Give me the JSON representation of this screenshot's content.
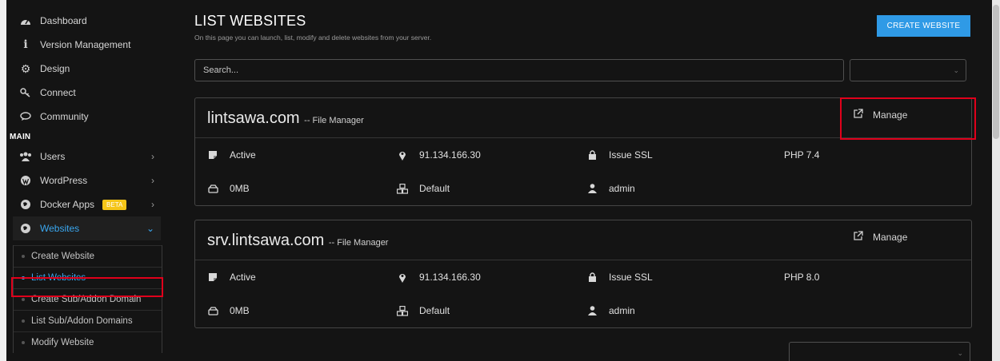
{
  "sidebar": {
    "top_items": [
      {
        "label": "Dashboard",
        "icon": "dashboard-icon"
      },
      {
        "label": "Version Management",
        "icon": "info-icon"
      },
      {
        "label": "Design",
        "icon": "gear-icon"
      },
      {
        "label": "Connect",
        "icon": "key-icon"
      },
      {
        "label": "Community",
        "icon": "chat-icon"
      }
    ],
    "section_main": "MAIN",
    "main_items": [
      {
        "label": "Users",
        "chevron": "›"
      },
      {
        "label": "WordPress",
        "chevron": "›"
      },
      {
        "label": "Docker Apps",
        "badge": "BETA",
        "chevron": "›"
      },
      {
        "label": "Websites",
        "chevron": "⌄"
      }
    ],
    "submenu": [
      {
        "label": "Create Website"
      },
      {
        "label": "List Websites"
      },
      {
        "label": "Create Sub/Addon Domain"
      },
      {
        "label": "List Sub/Addon Domains"
      },
      {
        "label": "Modify Website"
      }
    ]
  },
  "header": {
    "title": "LIST WEBSITES",
    "subtitle": "On this page you can launch, list, modify and delete websites from your server.",
    "create_button": "CREATE WEBSITE"
  },
  "search": {
    "placeholder": "Search..."
  },
  "websites": [
    {
      "domain": "lintsawa.com",
      "file_manager": "-- File Manager",
      "manage": "Manage",
      "status": "Active",
      "ip": "91.134.166.30",
      "ssl": "Issue SSL",
      "php": "PHP 7.4",
      "disk": "0MB",
      "package": "Default",
      "owner": "admin"
    },
    {
      "domain": "srv.lintsawa.com",
      "file_manager": "-- File Manager",
      "manage": "Manage",
      "status": "Active",
      "ip": "91.134.166.30",
      "ssl": "Issue SSL",
      "php": "PHP 8.0",
      "disk": "0MB",
      "package": "Default",
      "owner": "admin"
    }
  ],
  "colors": {
    "accent": "#2f9ae6",
    "link_active": "#3aa7ef",
    "highlight": "#e0001b",
    "beta": "#f5c518",
    "background": "#141414"
  }
}
